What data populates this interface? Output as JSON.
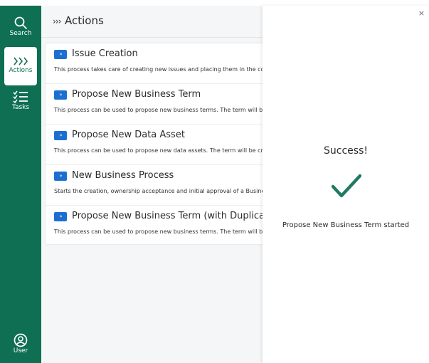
{
  "sidebar": {
    "items": [
      {
        "label": "Search",
        "icon": "search-icon"
      },
      {
        "label": "Actions",
        "icon": "chevrons-right-icon"
      },
      {
        "label": "Tasks",
        "icon": "checklist-icon"
      }
    ],
    "user": {
      "label": "User",
      "icon": "user-circle-icon"
    }
  },
  "header": {
    "icon_glyph": "›››",
    "title": "Actions"
  },
  "actions": [
    {
      "badge": "»",
      "title": "Issue Creation",
      "description": "This process takes care of creating new issues and placing them in the co"
    },
    {
      "badge": "»",
      "title": "Propose New Business Term",
      "description": "This process can be used to propose new business terms. The term will b"
    },
    {
      "badge": "»",
      "title": "Propose New Data Asset",
      "description": "This process can be used to propose new data assets. The term will be cr"
    },
    {
      "badge": "»",
      "title": "New Business Process",
      "description": "Starts the creation, ownership acceptance and initial approval of a Busine"
    },
    {
      "badge": "»",
      "title": "Propose New Business Term (with Duplicate Check",
      "description": "This process can be used to propose new business terms. The term will b"
    }
  ],
  "panel": {
    "close": "×",
    "success_title": "Success!",
    "message": "Propose New Business Term started"
  },
  "colors": {
    "sidebar": "#0e6f52",
    "badge": "#1c6fd1",
    "check": "#1f7a63"
  }
}
